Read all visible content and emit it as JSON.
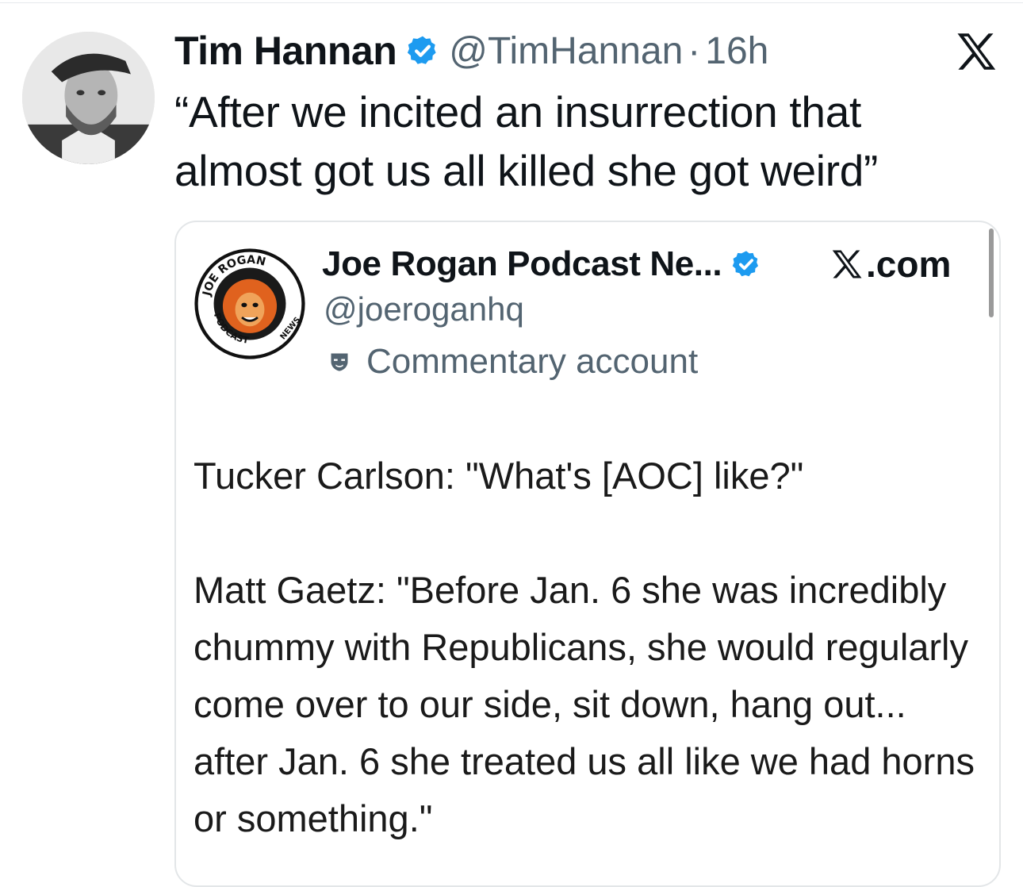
{
  "tweet": {
    "author_name": "Tim Hannan",
    "handle": "@TimHannan",
    "separator": "·",
    "time": "16h",
    "text": "“After we incited an insurrection that almost got us all killed she got weird”"
  },
  "quoted": {
    "author_name": "Joe Rogan Podcast Ne...",
    "site": ".com",
    "handle": "@joeroganhq",
    "badge": "Commentary account",
    "logo_text": {
      "top": "JOE ROGAN",
      "bottom": "PODCAST",
      "side": "NEWS"
    },
    "paragraphs": [
      "Tucker Carlson: \"What's [AOC] like?\"",
      "Matt Gaetz: \"Before Jan. 6 she was incredibly chummy with Republicans, she would regularly come over to our side, sit down, hang out... after Jan. 6 she treated us all like we had horns or something.\""
    ]
  },
  "icons": {
    "verified": "verified-badge-icon",
    "brand": "x-logo-icon",
    "commentary": "commentary-mask-icon"
  },
  "colors": {
    "verified_blue": "#1d9bf0",
    "secondary_text": "#536471",
    "primary_text": "#0f1419"
  }
}
